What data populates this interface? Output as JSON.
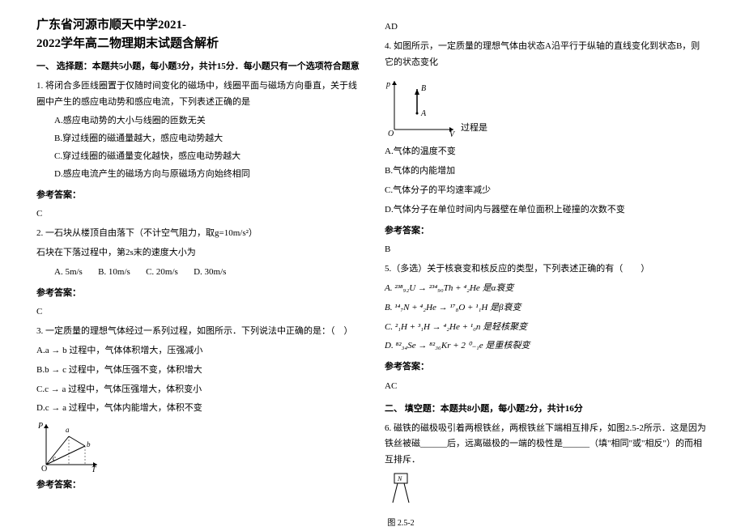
{
  "title_line1": "广东省河源市顺天中学2021-",
  "title_line2": "2022学年高二物理期末试题含解析",
  "section1_header": "一、 选择题：本题共5小题，每小题3分，共计15分．每小题只有一个选项符合题意",
  "q1_text": "1. 将闭合多匝线圈置于仅随时间变化的磁场中，线圈平面与磁场方向垂直，关于线圈中产生的感应电动势和感应电流，下列表述正确的是",
  "q1_A": "A.感应电动势的大小与线圈的匝数无关",
  "q1_B": "B.穿过线圈的磁通量越大，感应电动势越大",
  "q1_C": "C.穿过线圈的磁通量变化越快，感应电动势越大",
  "q1_D": "D.感应电流产生的磁场方向与原磁场方向始终相同",
  "answer_label": "参考答案：",
  "q1_answer": "C",
  "q2_text1": "2. 一石块从楼顶自由落下（不计空气阻力，取g=10m/s²）",
  "q2_text2": "石块在下落过程中，第2s末的速度大小为",
  "q2_A": "A. 5m/s",
  "q2_B": "B. 10m/s",
  "q2_C": "C. 20m/s",
  "q2_D": "D. 30m/s",
  "q2_answer": "C",
  "q3_text": "3. 一定质量的理想气体经过一系列过程，如图所示．下列说法中正确的是：（　）",
  "q3_A": "A.a → b 过程中，气体体积增大，压强减小",
  "q3_B": "B.b → c 过程中，气体压强不变，体积增大",
  "q3_C": "C.c → a 过程中，气体压强增大，体积变小",
  "q3_D": "D.c → a 过程中，气体内能增大，体积不变",
  "q3_answer": "AD",
  "q4_text1": "4. 如图所示，一定质量的理想气体由状态A沿平行于纵轴的直线变化到状态B，则它的状态变化",
  "q4_text2": "过程是",
  "q4_A": "A.气体的温度不变",
  "q4_B": "B.气体的内能增加",
  "q4_C": "C.气体分子的平均速率减少",
  "q4_D": "D.气体分子在单位时间内与器壁在单位面积上碰撞的次数不变",
  "q4_answer": "B",
  "q5_text": "5.（多选）关于核衰变和核反应的类型，下列表述正确的有（　　）",
  "q5_A": "A. ²³⁸₉₂U → ²³⁴₉₀Th + ⁴₂He 是α衰变",
  "q5_B": "B. ¹⁴₇N + ⁴₂He → ¹⁷₈O + ¹₁H 是β衰变",
  "q5_C": "C. ²₁H + ³₁H → ⁴₂He + ¹₀n 是轻核聚变",
  "q5_D": "D. ⁸²₃₄Se → ⁸²₃₆Kr + 2 ⁰₋₁e 是重核裂变",
  "q5_answer": "AC",
  "section2_header": "二、 填空题：本题共8小题，每小题2分，共计16分",
  "q6_text": "6. 磁铁的磁极吸引着两根铁丝，两根铁丝下端相互排斥，如图2.5-2所示．这是因为铁丝被磁______后，远离磁极的一端的极性是______（填\"相同\"或\"相反\"）的而相互排斥．",
  "fig25_label": "图 2.5-2"
}
